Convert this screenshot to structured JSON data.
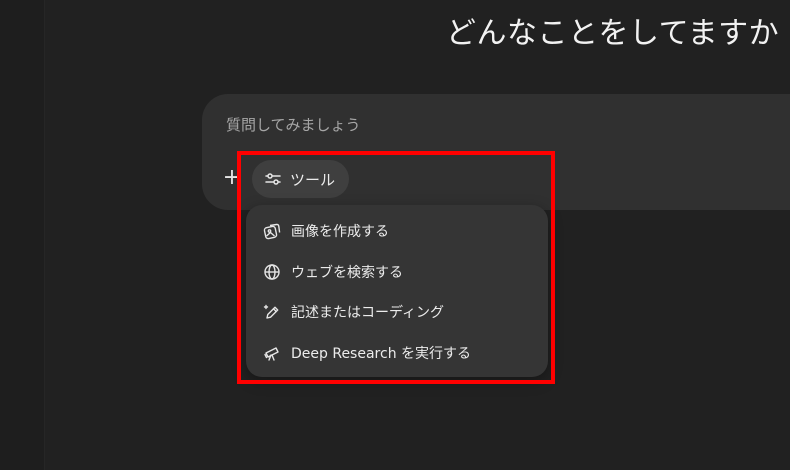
{
  "header": {
    "title": "どんなことをしてますか"
  },
  "composer": {
    "placeholder": "質問してみましょう",
    "plus_label": "+",
    "tools_label": "ツール"
  },
  "tools_menu": {
    "items": [
      {
        "label": "画像を作成する",
        "icon": "image-create-icon"
      },
      {
        "label": "ウェブを検索する",
        "icon": "globe-icon"
      },
      {
        "label": "記述またはコーディング",
        "icon": "pen-sparkle-icon"
      },
      {
        "label": "Deep Research を実行する",
        "icon": "telescope-icon"
      }
    ]
  },
  "annotation": {
    "highlight_color": "#ff0000"
  }
}
